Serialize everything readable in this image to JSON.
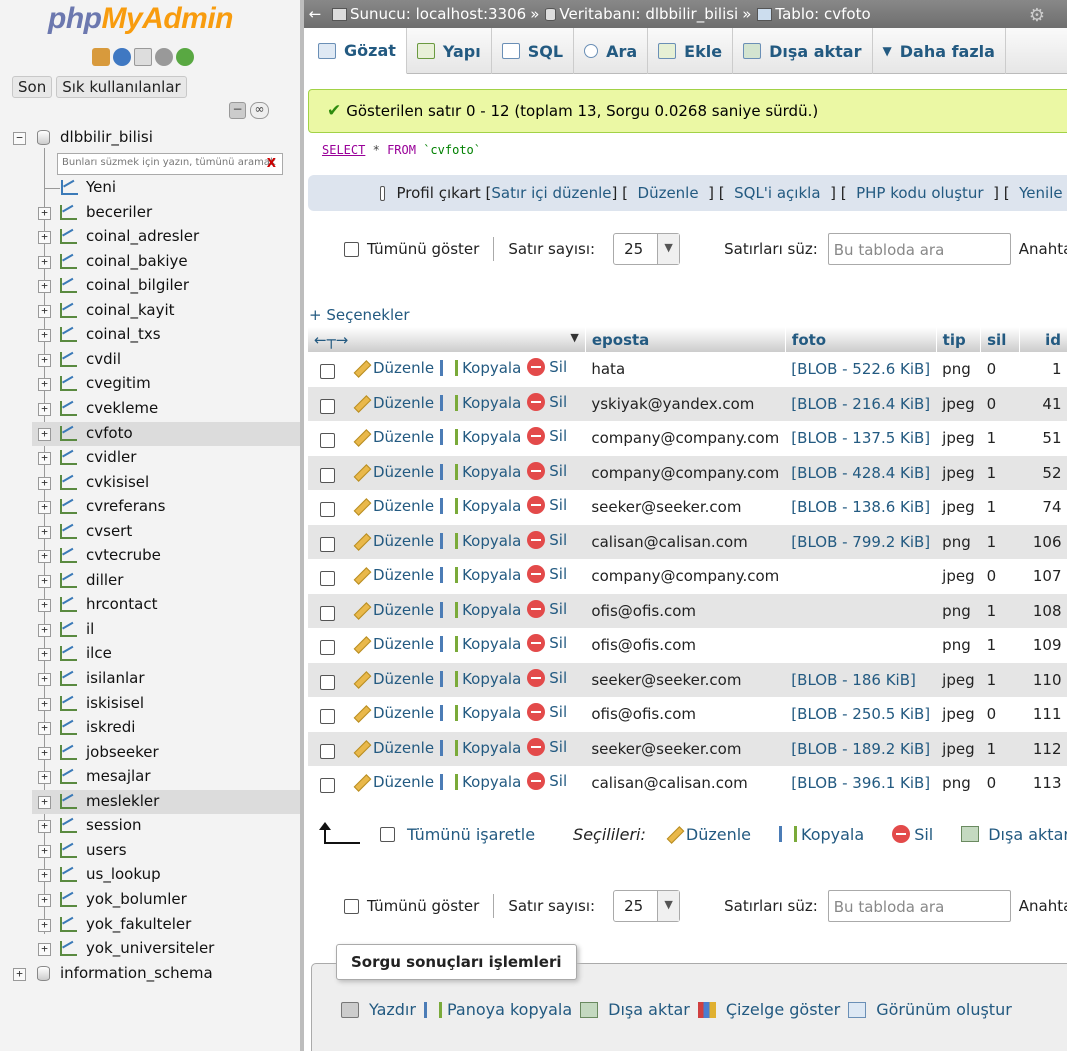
{
  "sidebar": {
    "logo_php": "php",
    "logo_myadmin": "MyAdmin",
    "nav_recent": "Son",
    "nav_favorites": "Sık kullanılanlar",
    "db_name": "dlbbilir_bilisi",
    "filter_placeholder": "Bunları süzmek için yazın, tümünü aramak",
    "filter_clear": "X",
    "new_label": "Yeni",
    "tables": [
      "beceriler",
      "coinal_adresler",
      "coinal_bakiye",
      "coinal_bilgiler",
      "coinal_kayit",
      "coinal_txs",
      "cvdil",
      "cvegitim",
      "cvekleme",
      "cvfoto",
      "cvidler",
      "cvkisisel",
      "cvreferans",
      "cvsert",
      "cvtecrube",
      "diller",
      "hrcontact",
      "il",
      "ilce",
      "isilanlar",
      "iskisisel",
      "iskredi",
      "jobseeker",
      "mesajlar",
      "meslekler",
      "session",
      "users",
      "us_lookup",
      "yok_bolumler",
      "yok_fakulteler",
      "yok_universiteler"
    ],
    "selected_tables": [
      "cvfoto",
      "meslekler"
    ],
    "other_db": "information_schema"
  },
  "breadcrumb": {
    "server": "Sunucu: localhost:3306",
    "database": "Veritabanı: dlbbilir_bilisi",
    "table": "Tablo: cvfoto",
    "separator": "»"
  },
  "tabs": [
    {
      "label": "Gözat",
      "active": true
    },
    {
      "label": "Yapı"
    },
    {
      "label": "SQL"
    },
    {
      "label": "Ara"
    },
    {
      "label": "Ekle"
    },
    {
      "label": "Dışa aktar"
    },
    {
      "label": "Daha fazla"
    }
  ],
  "success_message": "Gösterilen satır 0 - 12 (toplam 13, Sorgu 0.0268 saniye sürdü.)",
  "sql": {
    "select": "SELECT",
    "star": "*",
    "from": "FROM",
    "table": "`cvfoto`"
  },
  "profile": {
    "label": "Profil çıkart",
    "links": [
      "Satır içi düzenle",
      "Düzenle",
      "SQL'i açıkla",
      "PHP kodu oluştur",
      "Yenile"
    ]
  },
  "nav": {
    "show_all": "Tümünü göster",
    "rows_label": "Satır sayısı:",
    "rows_value": "25",
    "filter_label": "Satırları süz:",
    "filter_placeholder": "Bu tabloda ara",
    "key_label": "Anahta"
  },
  "options_link": "+ Seçenekler",
  "columns": [
    "eposta",
    "foto",
    "tip",
    "sil",
    "id"
  ],
  "actions": {
    "edit": "Düzenle",
    "copy": "Kopyala",
    "delete": "Sil"
  },
  "rows": [
    {
      "eposta": "hata",
      "foto": "[BLOB - 522.6 KiB]",
      "tip": "png",
      "sil": "0",
      "id": "1"
    },
    {
      "eposta": "yskiyak@yandex.com",
      "foto": "[BLOB - 216.4 KiB]",
      "tip": "jpeg",
      "sil": "0",
      "id": "41"
    },
    {
      "eposta": "company@company.com",
      "foto": "[BLOB - 137.5 KiB]",
      "tip": "jpeg",
      "sil": "1",
      "id": "51"
    },
    {
      "eposta": "company@company.com",
      "foto": "[BLOB - 428.4 KiB]",
      "tip": "jpeg",
      "sil": "1",
      "id": "52"
    },
    {
      "eposta": "seeker@seeker.com",
      "foto": "[BLOB - 138.6 KiB]",
      "tip": "jpeg",
      "sil": "1",
      "id": "74"
    },
    {
      "eposta": "calisan@calisan.com",
      "foto": "[BLOB - 799.2 KiB]",
      "tip": "png",
      "sil": "1",
      "id": "106"
    },
    {
      "eposta": "company@company.com",
      "foto": "",
      "tip": "jpeg",
      "sil": "0",
      "id": "107"
    },
    {
      "eposta": "ofis@ofis.com",
      "foto": "",
      "tip": "png",
      "sil": "1",
      "id": "108"
    },
    {
      "eposta": "ofis@ofis.com",
      "foto": "",
      "tip": "png",
      "sil": "1",
      "id": "109"
    },
    {
      "eposta": "seeker@seeker.com",
      "foto": "[BLOB - 186 KiB]",
      "tip": "jpeg",
      "sil": "1",
      "id": "110"
    },
    {
      "eposta": "ofis@ofis.com",
      "foto": "[BLOB - 250.5 KiB]",
      "tip": "jpeg",
      "sil": "0",
      "id": "111"
    },
    {
      "eposta": "seeker@seeker.com",
      "foto": "[BLOB - 189.2 KiB]",
      "tip": "jpeg",
      "sil": "1",
      "id": "112"
    },
    {
      "eposta": "calisan@calisan.com",
      "foto": "[BLOB - 396.1 KiB]",
      "tip": "png",
      "sil": "0",
      "id": "113"
    }
  ],
  "bulk": {
    "check_all": "Tümünü işaretle",
    "with_selected": "Seçilileri:",
    "edit": "Düzenle",
    "copy": "Kopyala",
    "delete": "Sil",
    "export": "Dışa aktar"
  },
  "operations": {
    "legend": "Sorgu sonuçları işlemleri",
    "print": "Yazdır",
    "copy_clipboard": "Panoya kopyala",
    "export": "Dışa aktar",
    "chart": "Çizelge göster",
    "create_view": "Görünüm oluştur"
  }
}
